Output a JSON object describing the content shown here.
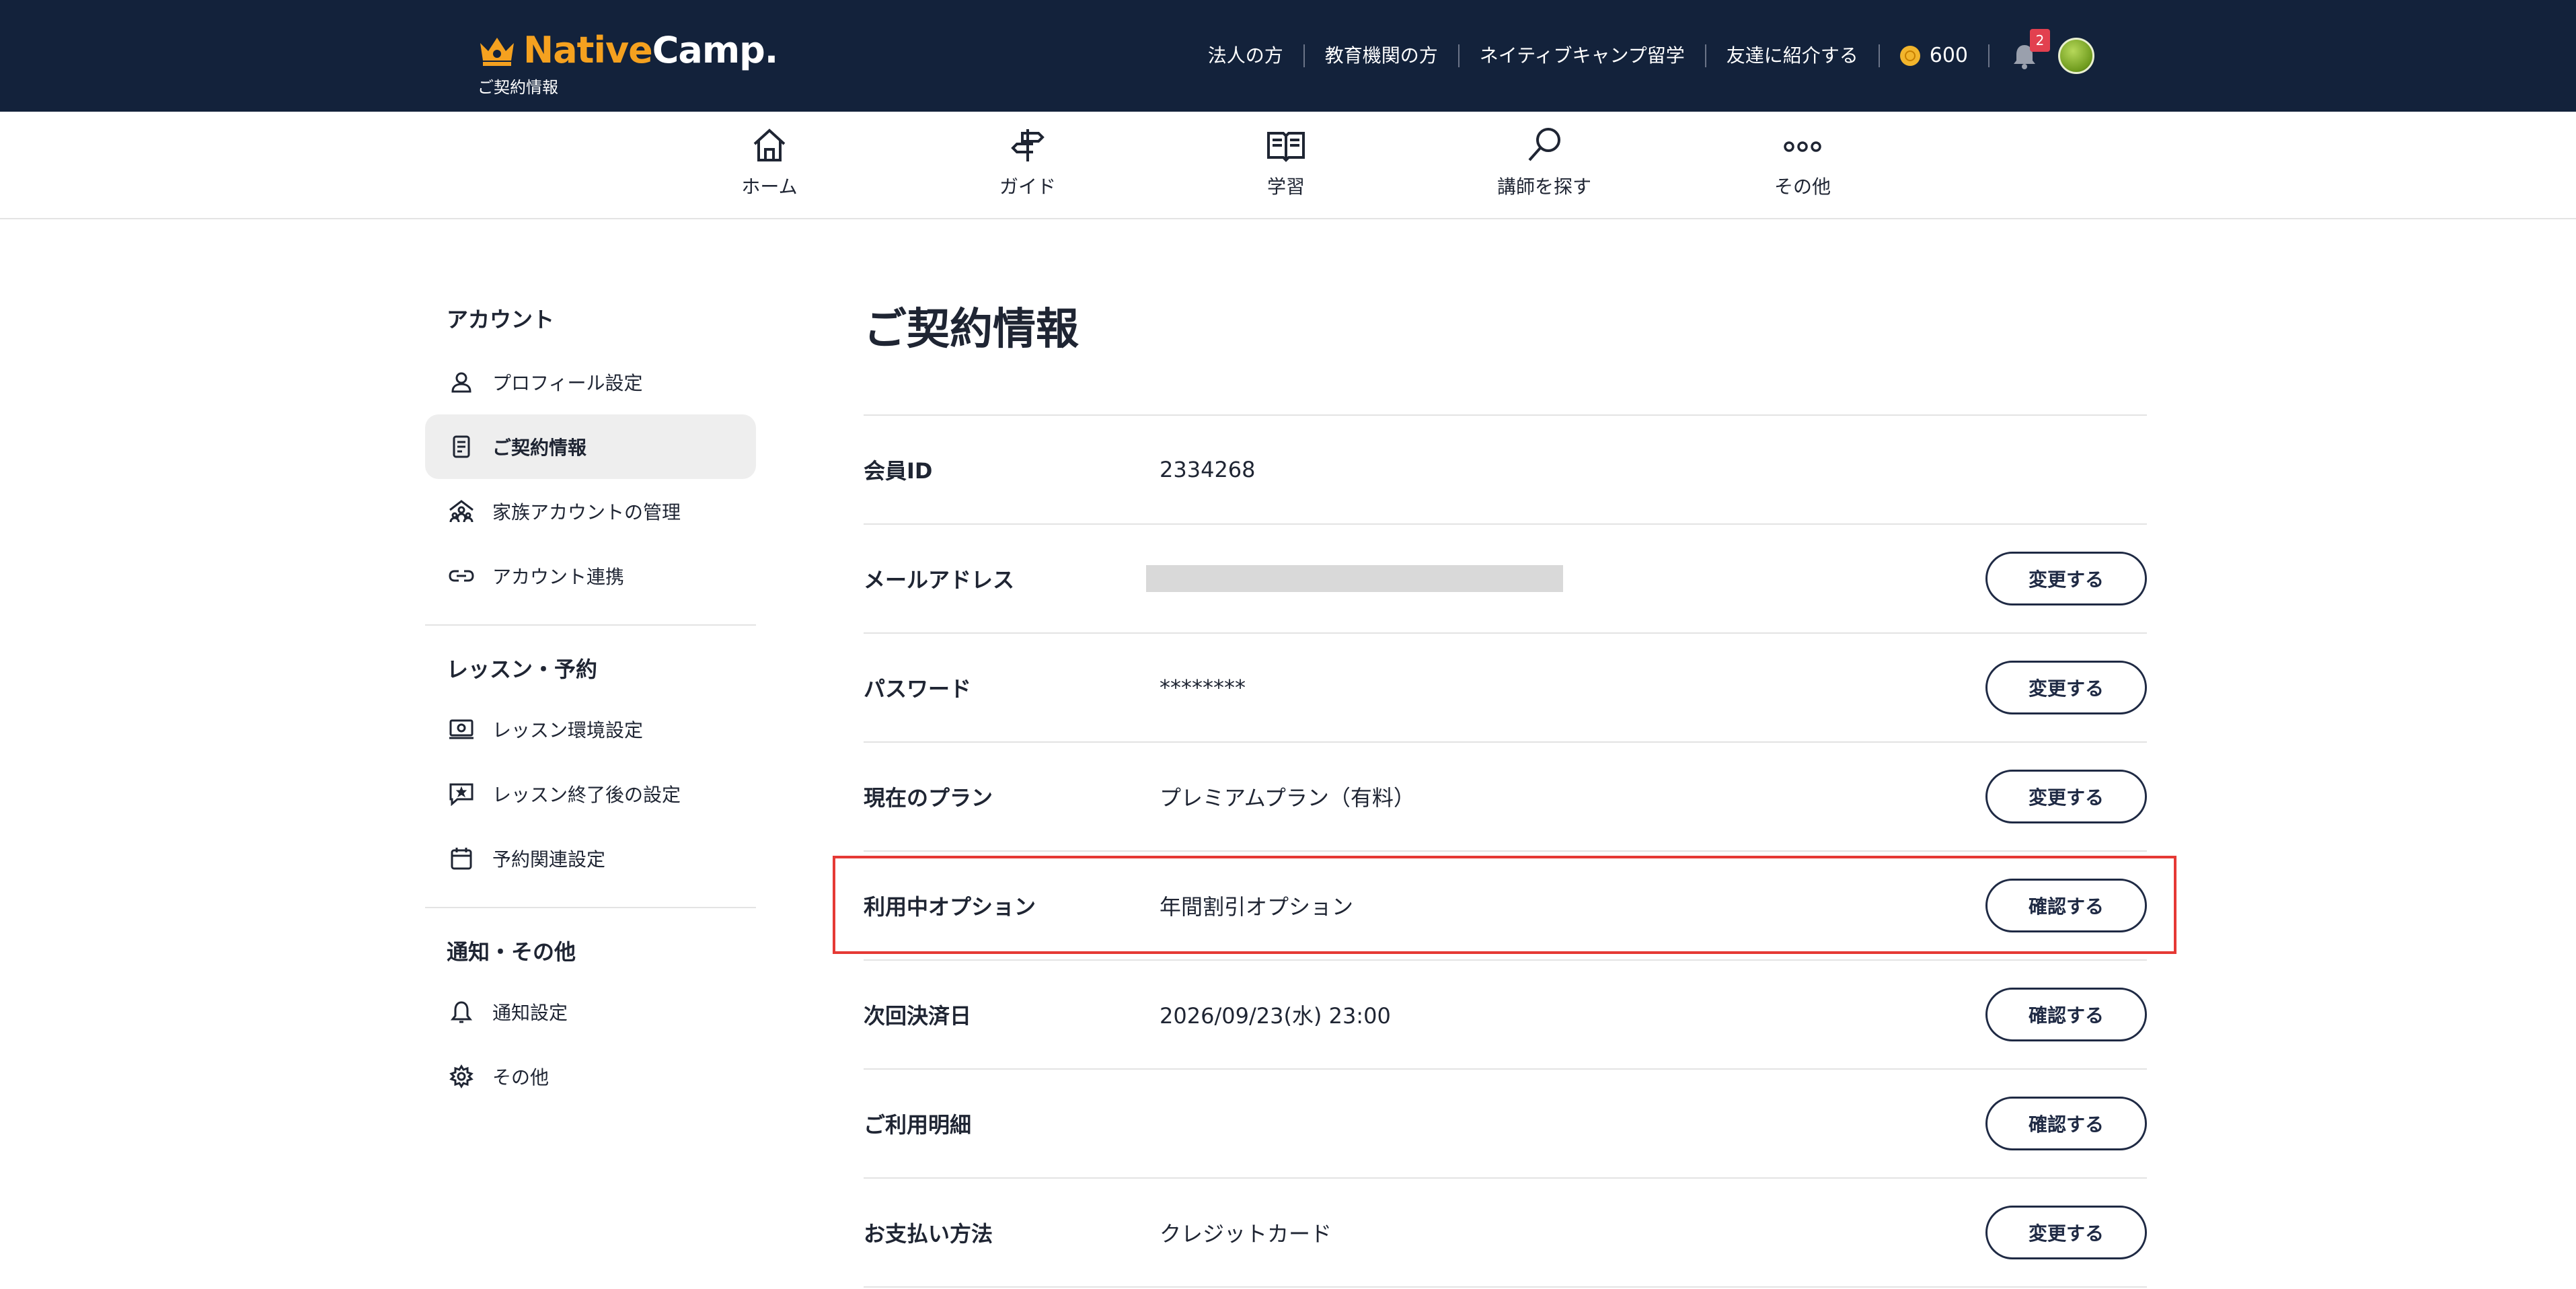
{
  "header": {
    "logo_native": "Native",
    "logo_camp": "Camp.",
    "subtitle": "ご契約情報",
    "links": [
      "法人の方",
      "教育機関の方",
      "ネイティブキャンプ留学",
      "友達に紹介する"
    ],
    "coins": "600",
    "notification_count": "2"
  },
  "nav": {
    "items": [
      {
        "label": "ホーム",
        "icon": "home-icon"
      },
      {
        "label": "ガイド",
        "icon": "signpost-icon"
      },
      {
        "label": "学習",
        "icon": "book-icon"
      },
      {
        "label": "講師を探す",
        "icon": "search-icon"
      },
      {
        "label": "その他",
        "icon": "more-dots-icon"
      }
    ]
  },
  "sidebar": {
    "sections": [
      {
        "title": "アカウント",
        "items": [
          {
            "label": "プロフィール設定",
            "icon": "user-icon"
          },
          {
            "label": "ご契約情報",
            "icon": "document-icon",
            "active": true
          },
          {
            "label": "家族アカウントの管理",
            "icon": "family-icon"
          },
          {
            "label": "アカウント連携",
            "icon": "link-icon"
          }
        ]
      },
      {
        "title": "レッスン・予約",
        "items": [
          {
            "label": "レッスン環境設定",
            "icon": "laptop-camera-icon"
          },
          {
            "label": "レッスン終了後の設定",
            "icon": "star-message-icon"
          },
          {
            "label": "予約関連設定",
            "icon": "calendar-icon"
          }
        ]
      },
      {
        "title": "通知・その他",
        "items": [
          {
            "label": "通知設定",
            "icon": "bell-icon"
          },
          {
            "label": "その他",
            "icon": "gear-icon"
          }
        ]
      }
    ]
  },
  "main": {
    "title": "ご契約情報",
    "rows": [
      {
        "label": "会員ID",
        "value": "2334268",
        "button": ""
      },
      {
        "label": "メールアドレス",
        "value": "",
        "masked": true,
        "button": "変更する"
      },
      {
        "label": "パスワード",
        "value": "********",
        "button": "変更する"
      },
      {
        "label": "現在のプラン",
        "value": "プレミアムプラン（有料）",
        "button": "変更する"
      },
      {
        "label": "利用中オプション",
        "value": "年間割引オプション",
        "button": "確認する",
        "highlighted": true
      },
      {
        "label": "次回決済日",
        "value": "2026/09/23(水) 23:00",
        "button": "確認する"
      },
      {
        "label": "ご利用明細",
        "value": "",
        "button": "確認する"
      },
      {
        "label": "お支払い方法",
        "value": "クレジットカード",
        "button": "変更する"
      }
    ]
  },
  "colors": {
    "header_bg": "#13223b",
    "accent_orange": "#f5a11f",
    "highlight_red": "#e53935",
    "badge_red": "#e2404f"
  }
}
